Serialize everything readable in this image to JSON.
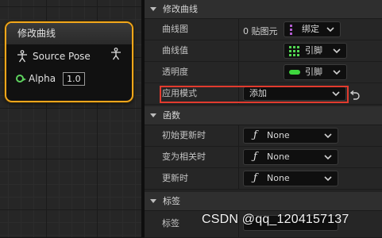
{
  "node": {
    "title": "修改曲线",
    "source_pose_label": "Source Pose",
    "alpha_label": "Alpha",
    "alpha_value": "1.0"
  },
  "details": {
    "section_modify_curve": "修改曲线",
    "rows": {
      "curve_map": {
        "label": "曲线图",
        "value_text": "0 贴图元",
        "combo": "绑定"
      },
      "curve_value": {
        "label": "曲线值",
        "combo": "引脚"
      },
      "alpha": {
        "label": "透明度",
        "combo": "引脚"
      },
      "apply_mode": {
        "label": "应用模式",
        "combo": "添加"
      }
    },
    "section_functions": "函数",
    "functions": [
      {
        "label": "初始更新时",
        "value": "None"
      },
      {
        "label": "变为相关时",
        "value": "None"
      },
      {
        "label": "更新时",
        "value": "None"
      }
    ],
    "section_tags": "标签",
    "tag_label": "标签"
  },
  "colors": {
    "node_border": "#f0a61c",
    "highlight": "#e23b2e",
    "bind_icon": "#b25ccf",
    "pin_grid_icon": "#52d552",
    "alpha_pill": "#3ed63e"
  },
  "icons": {
    "pose": "person-pose-icon",
    "alpha": "float-pin-icon",
    "reset": "reset-arrow-icon",
    "function": "function-icon"
  },
  "watermark": "CSDN @qq_1204157137"
}
